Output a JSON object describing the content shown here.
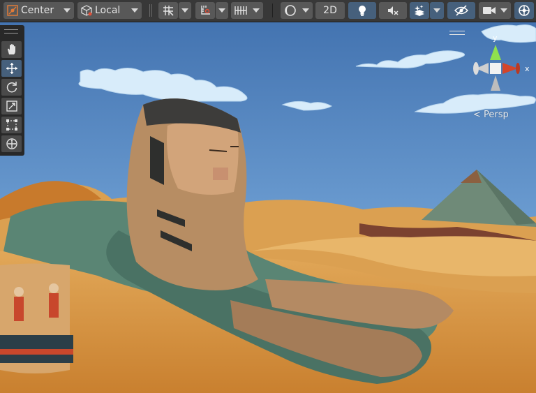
{
  "toolbar": {
    "pivot_mode": "Center",
    "pivot_rotation": "Local",
    "mode_2d": "2D",
    "icons": {
      "pivot_mode": "pivot-center-icon",
      "pivot_rotation": "local-cube-icon",
      "grid_snap": "grid-snap-icon",
      "incremental_snap": "incremental-snap-icon",
      "ruler": "ruler-icon",
      "draw_mode": "shading-mode-icon",
      "lighting": "lightbulb-icon",
      "audio": "audio-muted-icon",
      "effects": "effects-layers-icon",
      "visibility": "scene-visibility-icon",
      "camera": "camera-icon",
      "gizmos": "gizmos-icon"
    }
  },
  "tools": [
    "hand-tool",
    "move-tool",
    "rotate-tool",
    "scale-tool",
    "rect-tool",
    "transform-tool"
  ],
  "active_tool": "move-tool",
  "gizmo": {
    "y_label": "y",
    "x_label": "x",
    "projection": "< Persp"
  },
  "colors": {
    "toolbar_bg": "#383838",
    "button_bg": "#585858",
    "button_active": "#46607c",
    "axis_y": "#8fe04e",
    "axis_x": "#d3452b",
    "sky": "#4d7fb8",
    "sand": "#d9943b"
  }
}
